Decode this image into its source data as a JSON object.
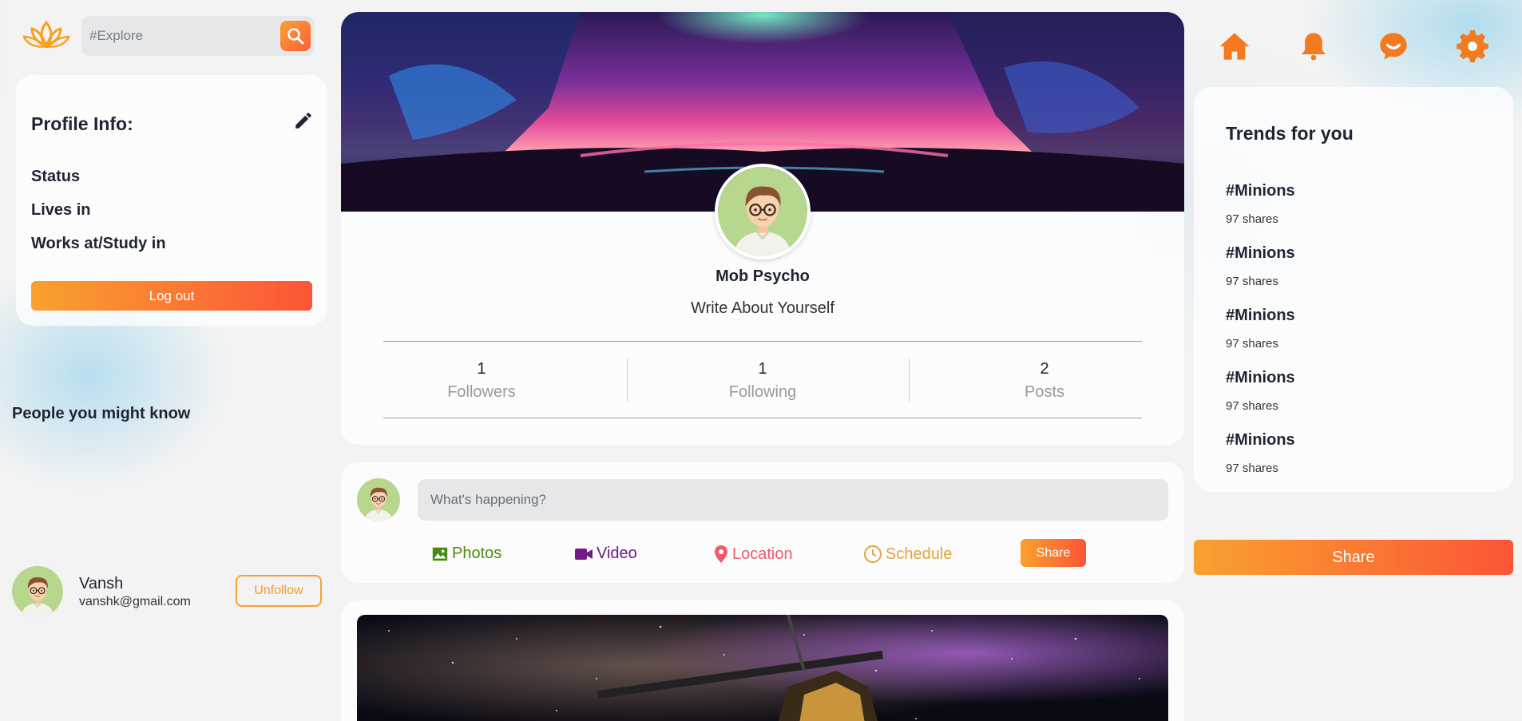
{
  "search": {
    "placeholder": "#Explore"
  },
  "profile_info": {
    "title": "Profile Info:",
    "rows": [
      "Status",
      "Lives in",
      "Works at/Study in"
    ],
    "logout_label": "Log out"
  },
  "people": {
    "title": "People you might know",
    "items": [
      {
        "name": "Vansh",
        "email": "vanshk@gmail.com",
        "action": "Unfollow"
      }
    ]
  },
  "profile": {
    "name": "Mob Psycho",
    "bio": "Write About Yourself",
    "stats": [
      {
        "value": "1",
        "label": "Followers"
      },
      {
        "value": "1",
        "label": "Following"
      },
      {
        "value": "2",
        "label": "Posts"
      }
    ]
  },
  "composer": {
    "placeholder": "What's happening?",
    "options": [
      {
        "label": "Photos",
        "icon": "image-icon",
        "color": "#4a8a13"
      },
      {
        "label": "Video",
        "icon": "video-icon",
        "color": "#6f1a86"
      },
      {
        "label": "Location",
        "icon": "location-pin-icon",
        "color": "#ef5b6b"
      },
      {
        "label": "Schedule",
        "icon": "clock-icon",
        "color": "#e0a53f"
      }
    ],
    "share_label": "Share"
  },
  "nav": {
    "icons": [
      "home-icon",
      "bell-icon",
      "chat-icon",
      "gear-icon"
    ]
  },
  "trends": {
    "title": "Trends for you",
    "items": [
      {
        "tag": "#Minions",
        "count": "97 shares"
      },
      {
        "tag": "#Minions",
        "count": "97 shares"
      },
      {
        "tag": "#Minions",
        "count": "97 shares"
      },
      {
        "tag": "#Minions",
        "count": "97 shares"
      },
      {
        "tag": "#Minions",
        "count": "97 shares"
      }
    ]
  },
  "share_big_label": "Share",
  "colors": {
    "accent_start": "#f9a12f",
    "accent_end": "#fb5537",
    "icon_orange": "#f37a1f"
  }
}
